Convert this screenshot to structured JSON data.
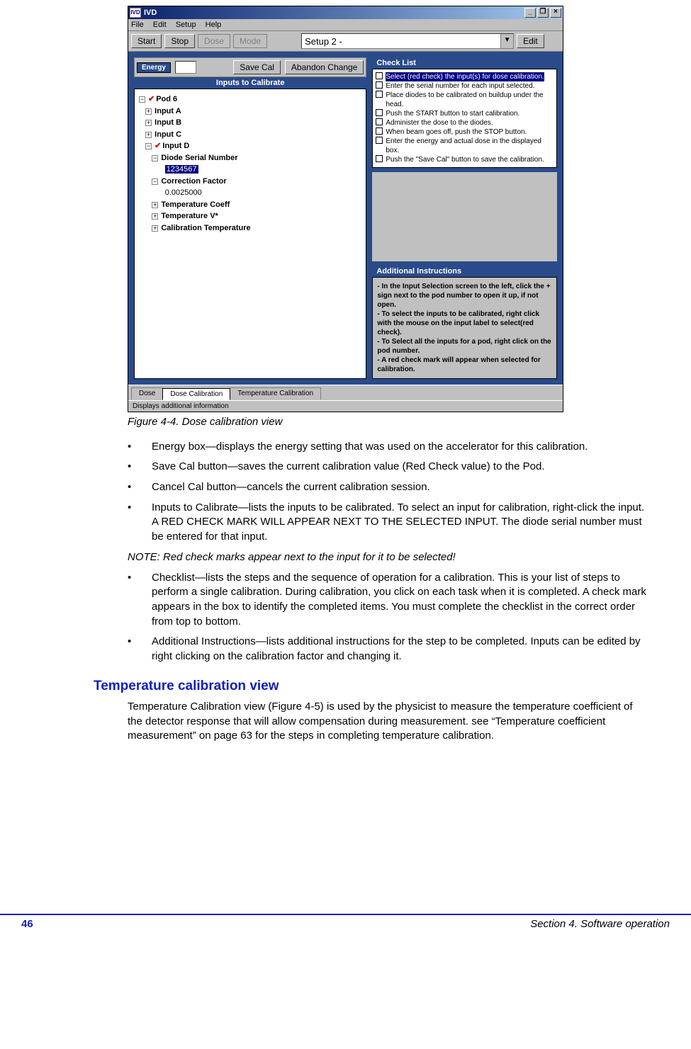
{
  "window": {
    "title": "IVD",
    "menus": [
      "File",
      "Edit",
      "Setup",
      "Help"
    ],
    "toolbar": {
      "start": "Start",
      "stop": "Stop",
      "dose": "Dose",
      "mode": "Mode",
      "setup_combo": "Setup 2 -",
      "edit": "Edit"
    },
    "energy_label": "Energy",
    "save_cal": "Save Cal",
    "abandon": "Abandon Change",
    "inputs_title": "Inputs to Calibrate",
    "tree": {
      "pod": "Pod 6",
      "a": "Input A",
      "b": "Input B",
      "c": "Input C",
      "d": "Input D",
      "dsn": "Diode Serial Number",
      "dsn_val": "1234567",
      "cf": "Correction Factor",
      "cf_val": "0.0025000",
      "tc": "Temperature Coeff",
      "tv": "Temperature V*",
      "ct": "Calibration Temperature"
    },
    "checklist_title": "Check List",
    "checklist": [
      "Select (red check) the input(s) for dose calibration.",
      "Enter the serial number for each input selected.",
      "Place diodes to be calibrated on buildup under the head.",
      "Push the START button to start calibration.",
      "Administer the dose to the diodes.",
      "When beam goes off, push the STOP button.",
      "Enter the energy and actual dose in the displayed box.",
      "Push the \"Save Cal\" button to save the calibration."
    ],
    "addl_title": "Additional Instructions",
    "addl": "- In the Input Selection screen to the left, click the + sign next to the pod number to open it up, if not open.\n- To select the inputs to be calibrated, right click with the mouse on the input label to select(red check).\n- To Select all the inputs for a pod, right click on the pod number.\n- A red check mark will appear when selected for calibration.",
    "tabs": {
      "dose": "Dose",
      "dosecal": "Dose Calibration",
      "tempcal": "Temperature Calibration"
    },
    "status": "Displays additional information"
  },
  "caption": "Figure 4-4. Dose calibration view",
  "bullets1": [
    "Energy box—displays the energy setting that was used on the accelerator for this calibration.",
    "Save Cal button—saves the current calibration value (Red Check value) to the Pod.",
    "Cancel Cal button—cancels the current calibration session.",
    "Inputs to Calibrate—lists the inputs to be calibrated. To select an input for calibration, right-click the input. A RED CHECK MARK WILL APPEAR NEXT TO THE SELECTED INPUT. The diode serial number must be entered for that input."
  ],
  "note": "NOTE: Red check marks appear next to the input for it to be selected!",
  "bullets2": [
    "Checklist—lists the steps and the sequence of operation for a calibration. This is your list of steps to perform a single calibration. During calibration, you click on each task when it is completed. A check mark appears in the box to identify the completed items. You must complete the checklist in the correct order from top to bottom.",
    "Additional Instructions—lists additional instructions for the step to be completed. Inputs can be edited by right clicking on the calibration factor and changing it."
  ],
  "section_heading": "Temperature calibration view",
  "section_body": "Temperature Calibration view (Figure 4-5) is used by the physicist to measure the temperature coefficient of the detector response that will allow compensation during measurement. see “Temperature coefficient measurement” on page 63 for the steps in completing temperature calibration.",
  "footer": {
    "page": "46",
    "section": "Section 4. Software operation"
  }
}
